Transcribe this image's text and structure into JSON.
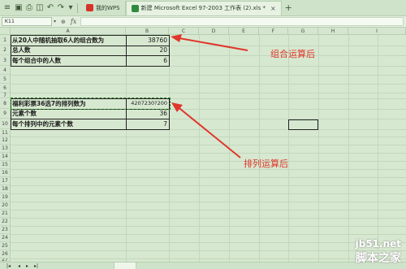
{
  "tabs": {
    "wps_label": "我的WPS",
    "file_label": "新建 Microsoft Excel 97-2003 工作表 (2).xls *",
    "close_glyph": "×",
    "add_glyph": "+"
  },
  "formula_bar": {
    "name_box": "K11",
    "fx_label": "fx",
    "value": ""
  },
  "columns": [
    "A",
    "B",
    "C",
    "D",
    "E",
    "F",
    "G",
    "H",
    "I"
  ],
  "rows": [
    "1",
    "2",
    "3",
    "4",
    "5",
    "6",
    "7",
    "8",
    "9",
    "10",
    "11",
    "12",
    "13",
    "14",
    "15",
    "16",
    "17",
    "18",
    "19",
    "20",
    "21",
    "22",
    "23",
    "24",
    "25",
    "26",
    "27"
  ],
  "cells": {
    "a1": "从20人中随机抽取6人的组合数为",
    "b1": "38760",
    "a2": "总人数",
    "b2": "20",
    "a3": "每个组合中的人数",
    "b3": "6",
    "a8": "福利彩票36选7的排列数为",
    "b8": "4207230?200",
    "a9": "元素个数",
    "b9": "36",
    "a10": "每个排列中的元素个数",
    "b10": "7"
  },
  "annotations": {
    "combination": "组合运算后",
    "permutation": "排列运算后"
  },
  "watermark": {
    "site": "jb51.net",
    "name": "脚本之家"
  },
  "colors": {
    "background": "#d7e8d0",
    "annotation": "#e0362b"
  }
}
